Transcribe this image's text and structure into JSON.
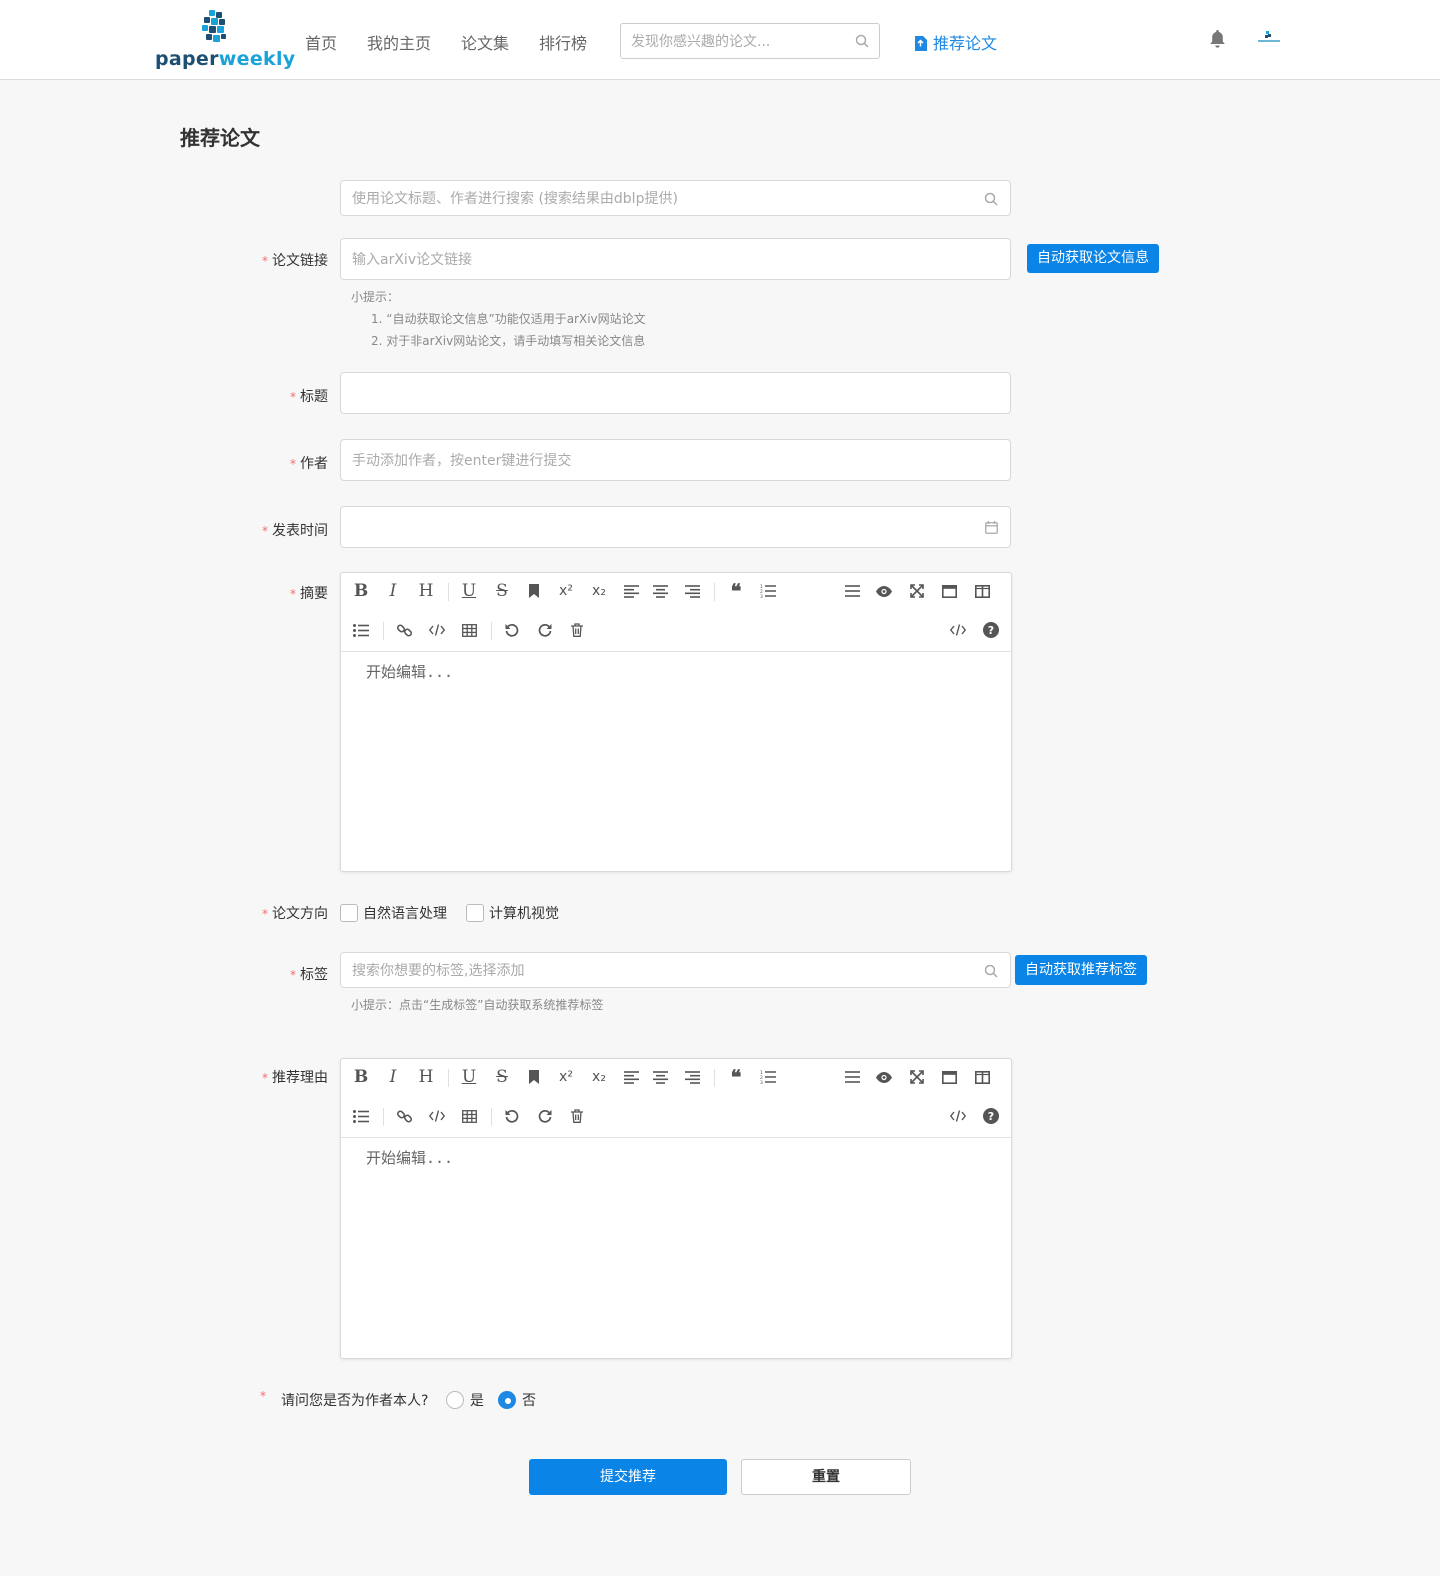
{
  "header": {
    "logo": {
      "part1": "paper",
      "part2": "weekly"
    },
    "nav": [
      "首页",
      "我的主页",
      "论文集",
      "排行榜"
    ],
    "search_placeholder": "发现你感兴趣的论文...",
    "recommend_label": "推荐论文",
    "icons": [
      "search-icon",
      "upload-doc-icon",
      "bell-icon",
      "avatar"
    ]
  },
  "page": {
    "title": "推荐论文",
    "dblp_search_placeholder": "使用论文标题、作者进行搜索 (搜索结果由dblp提供)",
    "link": {
      "label": "论文链接",
      "placeholder": "输入arXiv论文链接",
      "button": "自动获取论文信息",
      "hint_title": "小提示：",
      "hints": [
        "1. “自动获取论文信息”功能仅适用于arXiv网站论文",
        "2. 对于非arXiv网站论文，请手动填写相关论文信息"
      ]
    },
    "title_field": {
      "label": "标题",
      "value": ""
    },
    "authors": {
      "label": "作者",
      "placeholder": "手动添加作者，按enter键进行提交"
    },
    "publish_time": {
      "label": "发表时间",
      "value": ""
    },
    "abstract": {
      "label": "摘要",
      "placeholder": "开始编辑..."
    },
    "direction": {
      "label": "论文方向",
      "options": [
        "自然语言处理",
        "计算机视觉"
      ],
      "checked": [
        false,
        false
      ]
    },
    "tags": {
      "label": "标签",
      "placeholder": "搜索你想要的标签,选择添加",
      "button": "自动获取推荐标签",
      "hint": "小提示：点击“生成标签”自动获取系统推荐标签"
    },
    "reason": {
      "label": "推荐理由",
      "placeholder": "开始编辑..."
    },
    "is_author": {
      "question": "请问您是否为作者本人?",
      "options": [
        "是",
        "否"
      ],
      "selected": "否"
    },
    "submit": "提交推荐",
    "reset": "重置"
  },
  "colors": {
    "accent": "#0a84e6",
    "required": "#f56c6c",
    "background": "#f7f7f7"
  }
}
